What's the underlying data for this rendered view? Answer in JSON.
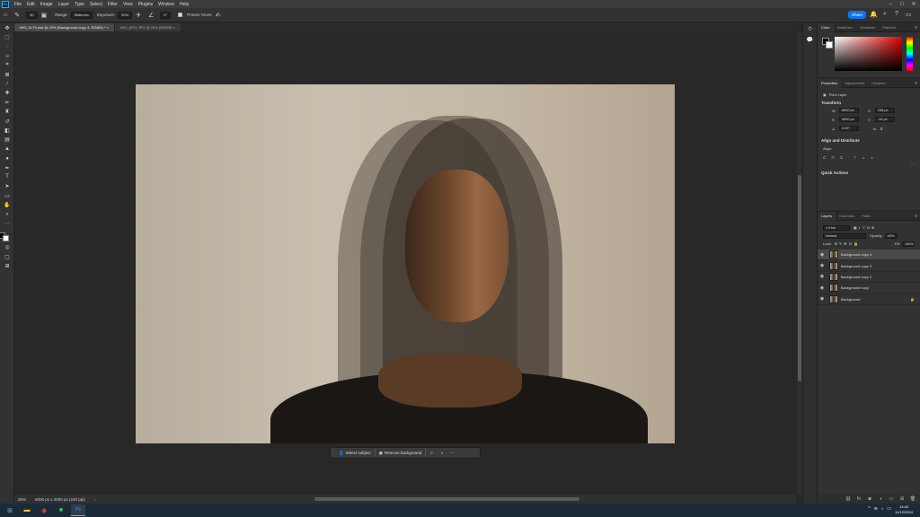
{
  "app": {
    "logo": "Ps",
    "title": "Adobe Photoshop"
  },
  "menu": [
    "File",
    "Edit",
    "Image",
    "Layer",
    "Type",
    "Select",
    "Filter",
    "View",
    "Plugins",
    "Window",
    "Help"
  ],
  "window_controls": {
    "minimize": "–",
    "maximize": "□",
    "close": "✕"
  },
  "options": {
    "range_label": "Range:",
    "range_value": "Midtones",
    "exposure_label": "Exposure:",
    "exposure_value": "50%",
    "angle_value": "0°",
    "protect_tones_label": "Protect Tones",
    "brush_size": "30"
  },
  "share_label": "Share",
  "tabs": [
    {
      "label": "IMG_6179.psd @ 25% (Background copy 4, RGB/8) *  ×"
    },
    {
      "label": "IMG_6231.JPG @ 25% (RGB/8)  ×"
    }
  ],
  "contextual_taskbar": {
    "select_subject": "Select subject",
    "remove_background": "Remove background",
    "more": "···"
  },
  "status": {
    "zoom": "25%",
    "doc_info": "6000 px x 4000 px (240 ppi)",
    "arrow": "›"
  },
  "color_panel": {
    "tabs": [
      "Color",
      "Swatches",
      "Gradients",
      "Patterns"
    ]
  },
  "properties_panel": {
    "tabs": [
      "Properties",
      "Adjustments",
      "Libraries"
    ],
    "layer_type": "Pixel Layer",
    "transform_title": "Transform",
    "w_label": "W",
    "w_value": "6000 px",
    "h_label": "H",
    "h_value": "4000 px",
    "x_label": "X",
    "x_value": "238 px",
    "y_label": "Y",
    "y_value": "-32 px",
    "angle_value": "0.00°",
    "align_title": "Align and Distribute",
    "align_label": "Align:",
    "quick_actions_title": "Quick Actions"
  },
  "layers_panel": {
    "tabs": [
      "Layers",
      "Channels",
      "Paths"
    ],
    "filter_kind": "Kind",
    "blend_mode": "Normal",
    "opacity_label": "Opacity:",
    "opacity_value": "42%",
    "lock_label": "Lock:",
    "fill_label": "Fill:",
    "fill_value": "100%",
    "layers": [
      {
        "name": "Background copy 4",
        "selected": true
      },
      {
        "name": "Background copy 3",
        "selected": false
      },
      {
        "name": "Background copy 2",
        "selected": false
      },
      {
        "name": "Background copy",
        "selected": false
      },
      {
        "name": "Background",
        "selected": false
      }
    ]
  },
  "taskbar": {
    "time": "14:42",
    "date": "11/12/2024"
  },
  "colors": {
    "accent": "#1473e6",
    "panel_bg": "#323232",
    "canvas_bg": "#282828",
    "menubar": "#3c3c3c"
  }
}
